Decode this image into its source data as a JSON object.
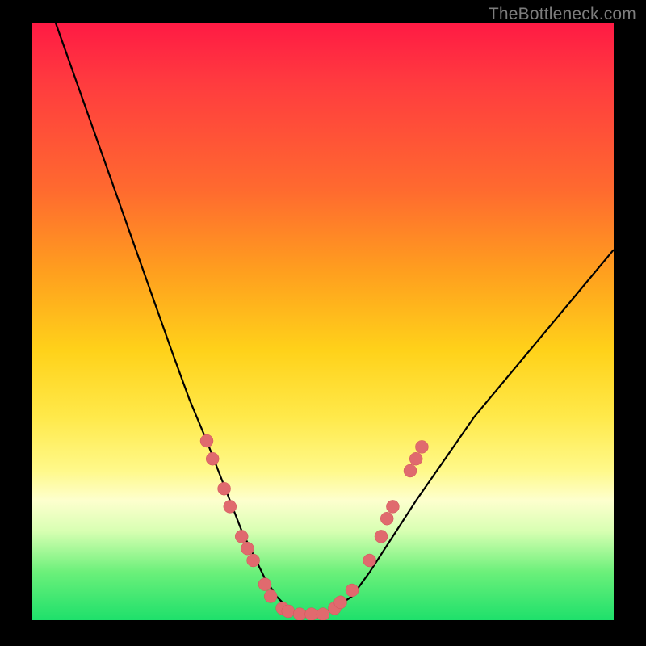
{
  "watermark": "TheBottleneck.com",
  "chart_data": {
    "type": "line",
    "title": "",
    "xlabel": "",
    "ylabel": "",
    "xlim": [
      0,
      100
    ],
    "ylim": [
      0,
      100
    ],
    "background_gradient": {
      "top": "#ff1a44",
      "upper_mid": "#ffa01e",
      "mid": "#ffe94a",
      "lower_mid": "#fdffce",
      "bottom": "#1ee06b"
    },
    "series": [
      {
        "name": "bottleneck-curve",
        "x": [
          4,
          8,
          12,
          16,
          20,
          24,
          27,
          30,
          32,
          34,
          36,
          38,
          40,
          42,
          44,
          46,
          48,
          50,
          52,
          55,
          58,
          62,
          66,
          71,
          76,
          82,
          88,
          94,
          100
        ],
        "y": [
          100,
          89,
          78,
          67,
          56,
          45,
          37,
          30,
          25,
          20,
          15,
          11,
          7,
          4,
          2,
          1,
          1,
          1,
          2,
          4,
          8,
          14,
          20,
          27,
          34,
          41,
          48,
          55,
          62
        ]
      }
    ],
    "markers": {
      "name": "highlighted-points",
      "color": "#e06a6e",
      "points": [
        {
          "x": 30,
          "y": 30
        },
        {
          "x": 31,
          "y": 27
        },
        {
          "x": 33,
          "y": 22
        },
        {
          "x": 34,
          "y": 19
        },
        {
          "x": 36,
          "y": 14
        },
        {
          "x": 37,
          "y": 12
        },
        {
          "x": 38,
          "y": 10
        },
        {
          "x": 40,
          "y": 6
        },
        {
          "x": 41,
          "y": 4
        },
        {
          "x": 43,
          "y": 2
        },
        {
          "x": 44,
          "y": 1.5
        },
        {
          "x": 46,
          "y": 1
        },
        {
          "x": 48,
          "y": 1
        },
        {
          "x": 50,
          "y": 1
        },
        {
          "x": 52,
          "y": 2
        },
        {
          "x": 53,
          "y": 3
        },
        {
          "x": 55,
          "y": 5
        },
        {
          "x": 58,
          "y": 10
        },
        {
          "x": 60,
          "y": 14
        },
        {
          "x": 61,
          "y": 17
        },
        {
          "x": 62,
          "y": 19
        },
        {
          "x": 65,
          "y": 25
        },
        {
          "x": 66,
          "y": 27
        },
        {
          "x": 67,
          "y": 29
        }
      ]
    }
  }
}
